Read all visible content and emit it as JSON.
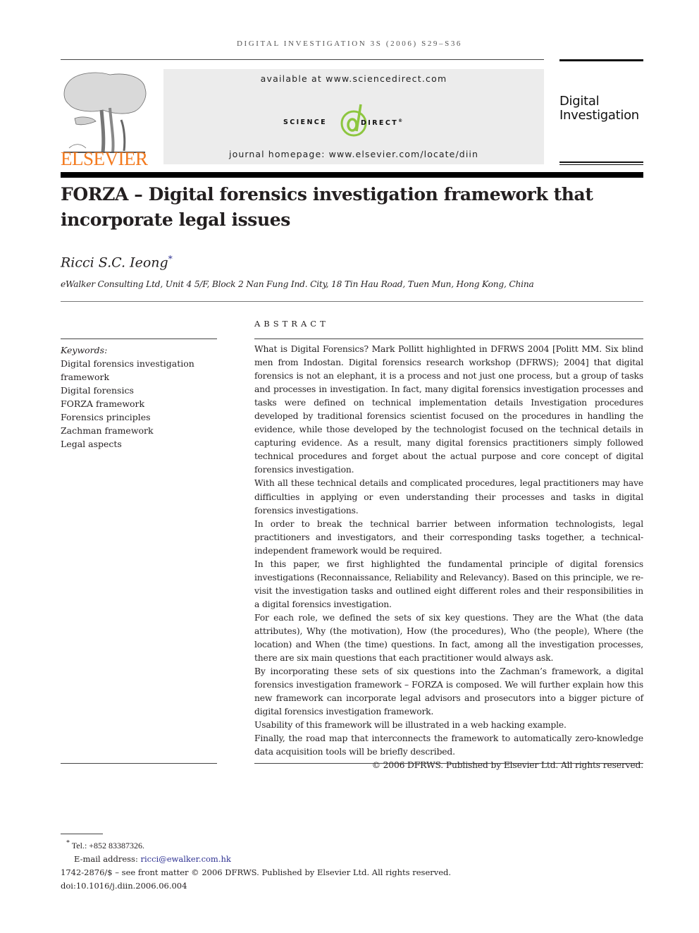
{
  "header": {
    "running_head": "Digital Investigation 3S (2006) S29–S36",
    "publisher_logo": "Elsevier",
    "available_at": "available at www.sciencedirect.com",
    "sciencedirect_left": "SCIENCE",
    "sciencedirect_right": "DIRECT",
    "sciencedirect_mark": "®",
    "journal_homepage": "journal homepage: www.elsevier.com/locate/diin",
    "journal_logo_line1": "Digital",
    "journal_logo_line2": "Investigation",
    "colors": {
      "elsevier_orange": "#f47b20",
      "sciencedirect_green": "#8dc63f",
      "banner_gray": "#ececec",
      "link_blue": "#2e3192"
    }
  },
  "article": {
    "title": "FORZA – Digital forensics investigation framework that incorporate legal issues",
    "author": "Ricci S.C. Ieong",
    "author_mark": "*",
    "affiliation": "eWalker Consulting Ltd, Unit 4 5/F, Block 2 Nan Fung Ind. City, 18 Tin Hau Road, Tuen Mun, Hong Kong, China"
  },
  "keywords": {
    "label": "Keywords:",
    "items": [
      "Digital forensics investigation framework",
      "Digital forensics",
      "FORZA framework",
      "Forensics principles",
      "Zachman framework",
      "Legal aspects"
    ]
  },
  "abstract": {
    "heading": "ABSTRACT",
    "paragraphs": [
      "What is Digital Forensics? Mark Pollitt highlighted in DFRWS 2004 [Politt MM. Six blind men from Indostan. Digital forensics research workshop (DFRWS); 2004] that digital forensics is not an elephant, it is a process and not just one process, but a group of tasks and processes in investigation. In fact, many digital forensics investigation processes and tasks were defined on technical implementation details Investigation procedures developed by traditional forensics scientist focused on the procedures in handling the evidence, while those developed by the technologist focused on the technical details in capturing evidence. As a result, many digital forensics practitioners simply followed technical procedures and forget about the actual purpose and core concept of digital forensics investigation.",
      "With all these technical details and complicated procedures, legal practitioners may have difficulties in applying or even understanding their processes and tasks in digital forensics investigations.",
      "In order to break the technical barrier between information technologists, legal practitioners and investigators, and their corresponding tasks together, a technical-independent framework would be required.",
      "In this paper, we first highlighted the fundamental principle of digital forensics investigations (Reconnaissance, Reliability and Relevancy). Based on this principle, we re-visit the investigation tasks and outlined eight different roles and their responsibilities in a digital forensics investigation.",
      "For each role, we defined the sets of six key questions. They are the What (the data attributes), Why (the motivation), How (the procedures), Who (the people), Where (the location) and When (the time) questions. In fact, among all the investigation processes, there are six main questions that each practitioner would always ask.",
      "By incorporating these sets of six questions into the Zachman’s framework, a digital forensics investigation framework – FORZA is composed. We will further explain how this new framework can incorporate legal advisors and prosecutors into a bigger picture of digital forensics investigation framework.",
      "Usability of this framework will be illustrated in a web hacking example.",
      "Finally, the road map that interconnects the framework to automatically zero-knowledge data acquisition tools will be briefly described."
    ],
    "copyright": "© 2006 DFRWS. Published by Elsevier Ltd. All rights reserved."
  },
  "footnotes": {
    "mark": "*",
    "tel": "Tel.: +852 83387326.",
    "email_label": "E-mail address: ",
    "email": "ricci@ewalker.com.hk",
    "front_matter": "1742-2876/$ – see front matter © 2006 DFRWS. Published by Elsevier Ltd. All rights reserved.",
    "doi": "doi:10.1016/j.diin.2006.06.004"
  }
}
